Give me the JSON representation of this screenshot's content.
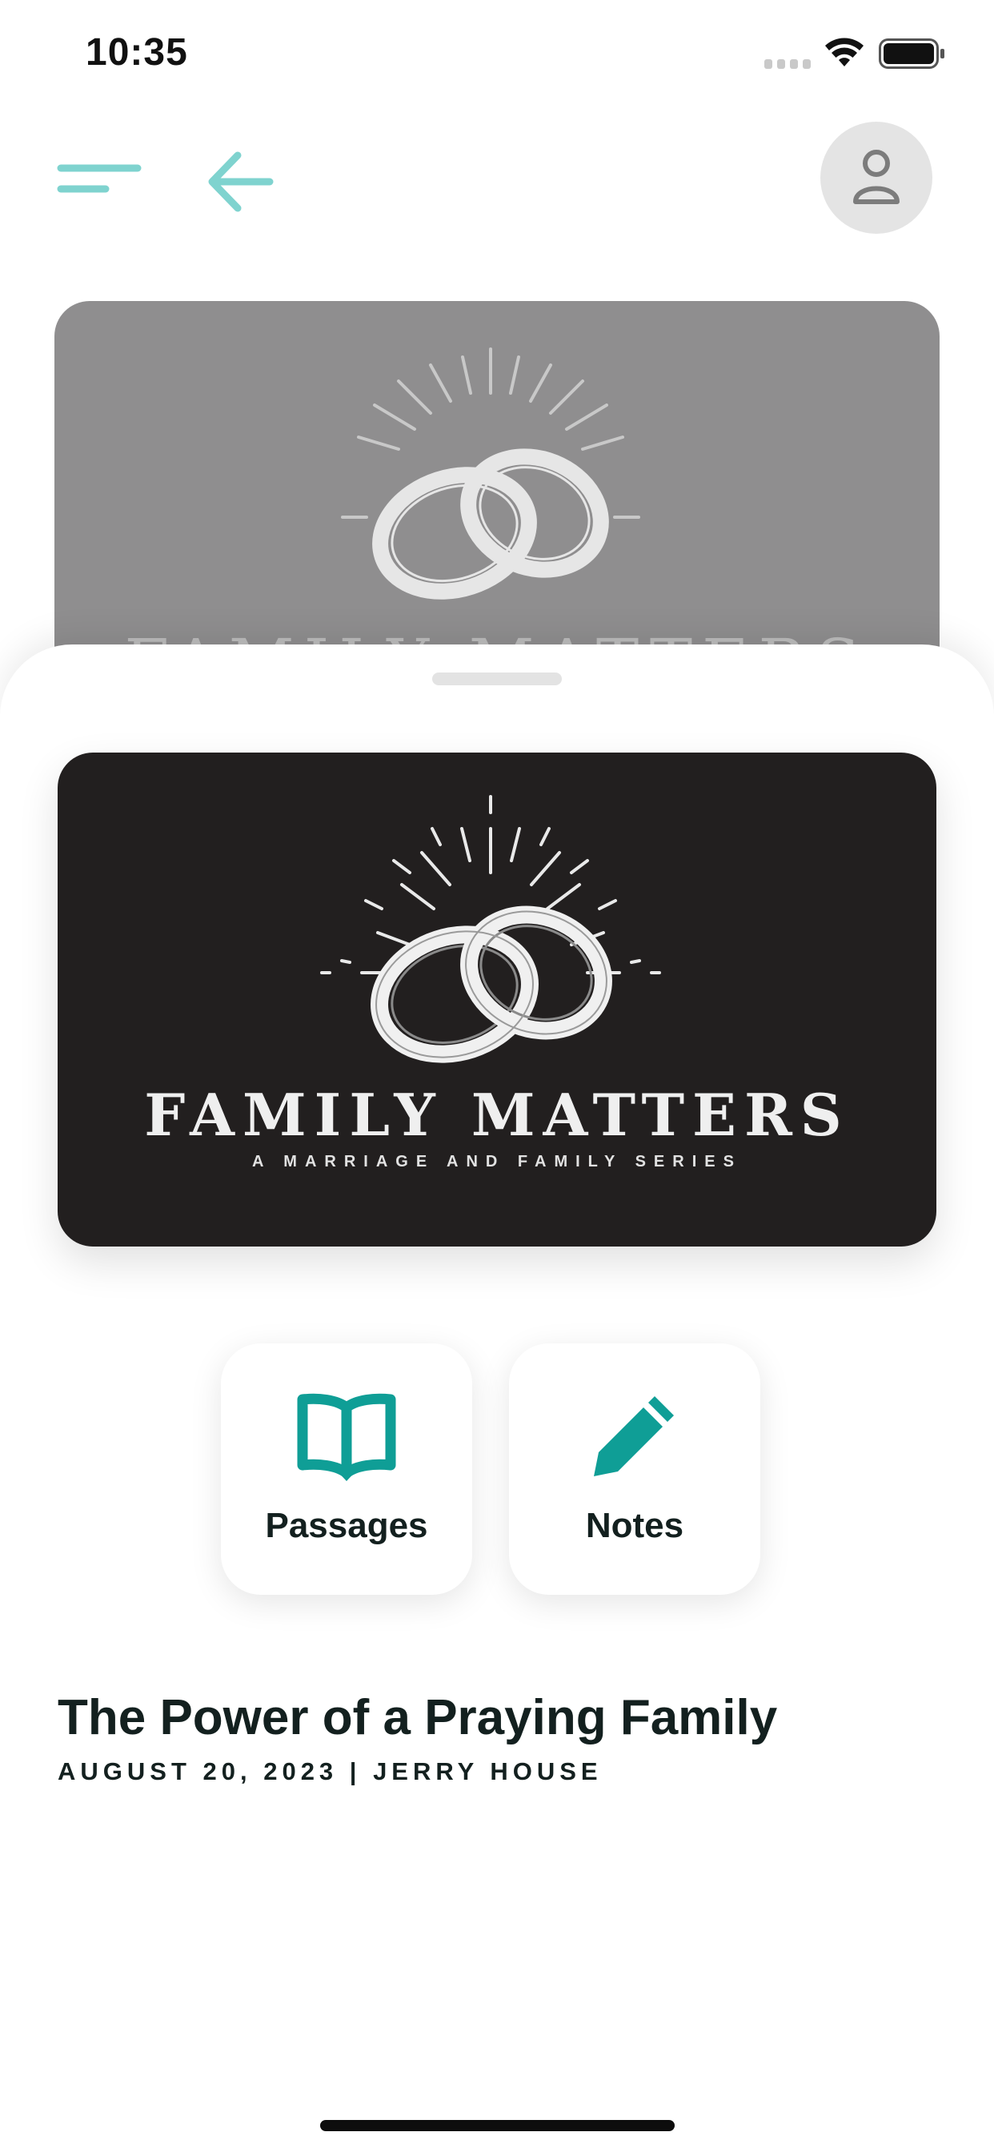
{
  "status_bar": {
    "time": "10:35"
  },
  "icons": {
    "menu": "menu-icon",
    "back": "arrow-left-icon",
    "profile": "person-icon",
    "passages": "open-book-icon",
    "notes": "pencil-icon"
  },
  "colors": {
    "accent": "#0f9e96",
    "accent_light": "#7fd3cf",
    "dark": "#13201f"
  },
  "background_card": {
    "title": "FAMILY MATTERS"
  },
  "hero": {
    "title": "FAMILY MATTERS",
    "subtitle": "A MARRIAGE AND FAMILY SERIES"
  },
  "actions": [
    {
      "label": "Passages"
    },
    {
      "label": "Notes"
    }
  ],
  "sermon": {
    "title": "The Power of a Praying Family",
    "meta": "AUGUST 20, 2023 | JERRY HOUSE"
  }
}
